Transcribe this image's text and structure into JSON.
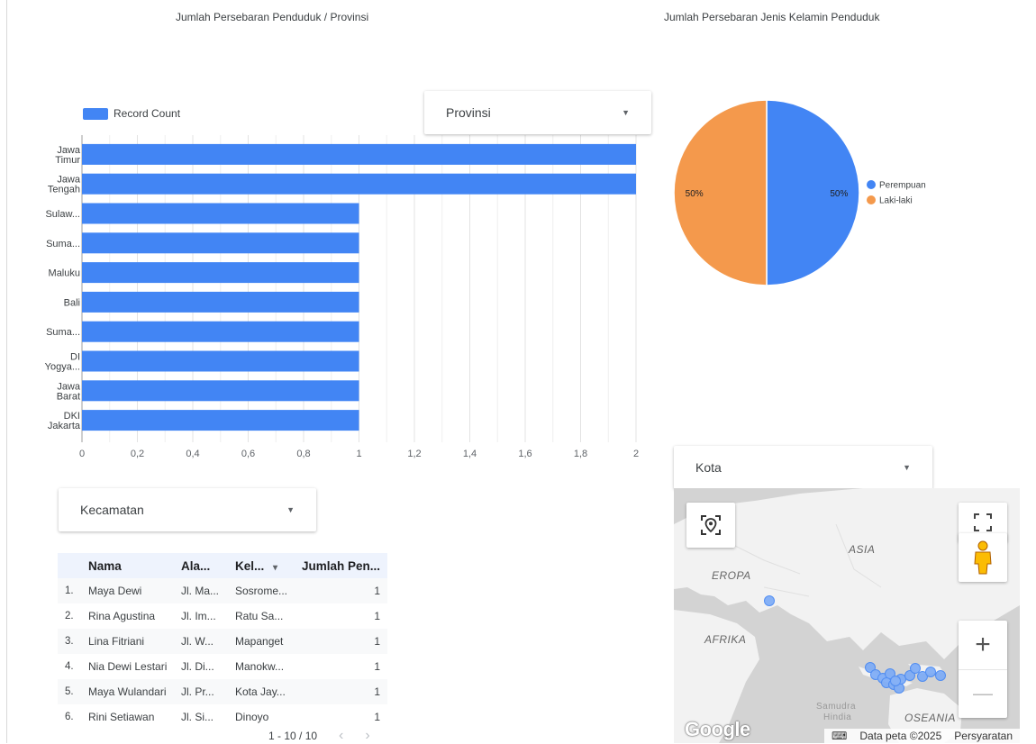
{
  "bar_chart": {
    "title": "Jumlah Persebaran Penduduk / Provinsi",
    "legend_label": "Record Count",
    "chart_data": {
      "type": "bar",
      "orientation": "horizontal",
      "categories": [
        [
          "Jawa",
          "Timur"
        ],
        [
          "Jawa",
          "Tengah"
        ],
        [
          "Sulaw..."
        ],
        [
          "Suma..."
        ],
        [
          "Maluku"
        ],
        [
          "Bali"
        ],
        [
          "Suma..."
        ],
        [
          "DI",
          "Yogya..."
        ],
        [
          "Jawa",
          "Barat"
        ],
        [
          "DKI",
          "Jakarta"
        ]
      ],
      "series": [
        {
          "name": "Record Count",
          "values": [
            2,
            2,
            1,
            1,
            1,
            1,
            1,
            1,
            1,
            1
          ]
        }
      ],
      "xlim": [
        0,
        2
      ],
      "x_ticks": [
        "0",
        "0,2",
        "0,4",
        "0,6",
        "0,8",
        "1",
        "1,2",
        "1,4",
        "1,6",
        "1,8",
        "2"
      ],
      "grid": true,
      "legend_position": "top-left",
      "color": "#4285f4"
    }
  },
  "provinsi_filter": {
    "label": "Provinsi"
  },
  "pie_chart": {
    "title": "Jumlah Persebaran Jenis Kelamin Penduduk",
    "chart_data": {
      "type": "pie",
      "slices": [
        {
          "name": "Perempuan",
          "value": 50,
          "label": "50%",
          "color": "#4285f4"
        },
        {
          "name": "Laki-laki",
          "value": 50,
          "label": "50%",
          "color": "#f4994c"
        }
      ],
      "legend_position": "right"
    }
  },
  "kecamatan_filter": {
    "label": "Kecamatan"
  },
  "kota_filter": {
    "label": "Kota"
  },
  "table": {
    "headers": {
      "nama": "Nama",
      "alamat": "Ala...",
      "kelurahan": "Kel...",
      "sort_icon": "▾",
      "jumlah": "Jumlah Pen..."
    },
    "rows": [
      {
        "no": "1.",
        "nama": "Maya Dewi",
        "alamat": "Jl. Ma...",
        "kelurahan": "Sosrome...",
        "jumlah": "1"
      },
      {
        "no": "2.",
        "nama": "Rina Agustina",
        "alamat": "Jl. Im...",
        "kelurahan": "Ratu Sa...",
        "jumlah": "1"
      },
      {
        "no": "3.",
        "nama": "Lina Fitriani",
        "alamat": "Jl. W...",
        "kelurahan": "Mapanget",
        "jumlah": "1"
      },
      {
        "no": "4.",
        "nama": "Nia Dewi Lestari",
        "alamat": "Jl. Di...",
        "kelurahan": "Manokw...",
        "jumlah": "1"
      },
      {
        "no": "5.",
        "nama": "Maya Wulandari",
        "alamat": "Jl. Pr...",
        "kelurahan": "Kota Jay...",
        "jumlah": "1"
      },
      {
        "no": "6.",
        "nama": "Rini Setiawan",
        "alamat": "Jl. Si...",
        "kelurahan": "Dinoyo",
        "jumlah": "1"
      }
    ],
    "pagination": "1 - 10 / 10"
  },
  "map": {
    "labels": {
      "asia": "ASIA",
      "eropa": "EROPA",
      "afrika": "AFRIKA",
      "oseania": "OSEANIA",
      "samudra": "Samudra",
      "hindia": "Hindia"
    },
    "footer": {
      "data": "Data peta ©2025",
      "terms": "Persyaratan"
    },
    "logo": "Google",
    "icons": {
      "locate": "location-icon",
      "fullscreen": "fullscreen-icon",
      "pegman": "pegman-icon",
      "zoom_in": "+",
      "zoom_out": "—"
    }
  }
}
